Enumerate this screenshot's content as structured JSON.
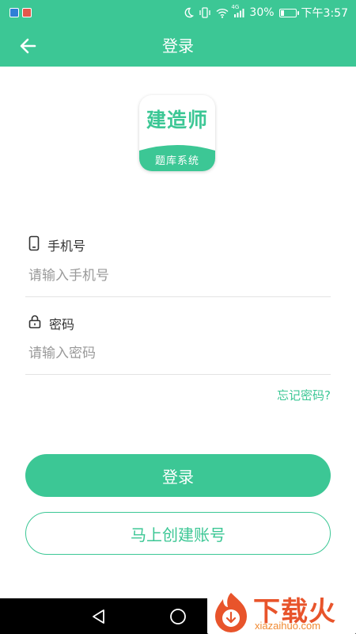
{
  "status_bar": {
    "signal": "4G",
    "battery_percent": "30%",
    "battery_level": 0.3,
    "time": "下午3:57"
  },
  "header": {
    "title": "登录"
  },
  "logo": {
    "brand": "建造师",
    "subtitle": "题库系统"
  },
  "form": {
    "phone_label": "手机号",
    "phone_placeholder": "请输入手机号",
    "phone_value": "",
    "password_label": "密码",
    "password_placeholder": "请输入密码",
    "password_value": "",
    "forgot_label": "忘记密码?"
  },
  "buttons": {
    "login_label": "登录",
    "register_label": "马上创建账号"
  },
  "watermark": {
    "title": "下载火",
    "domain": "xiazaihuo.com"
  },
  "icons": {
    "back": "arrow-left-icon",
    "phone": "phone-icon",
    "password": "lock-icon",
    "nav_back": "triangle-back-icon",
    "nav_home": "circle-home-icon"
  },
  "colors": {
    "accent": "#3cc795",
    "text": "#333333",
    "placeholder": "#9a9a9a",
    "divider": "#e3e3e3",
    "watermark_red": "#e8542b"
  }
}
